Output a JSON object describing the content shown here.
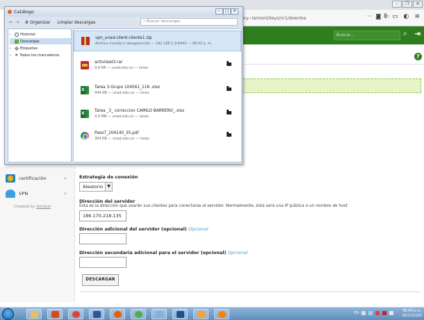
{
  "browser": {
    "url": "ory~lamient/keys/nr1/downloa",
    "search_placeholder": "Buscar..."
  },
  "catalog": {
    "title": "Catálogo",
    "organize_label": "Organizar",
    "clear_label": "Limpiar descargas",
    "search_placeholder": "Buscar descargas",
    "window_controls": [
      "–",
      "□",
      "✕"
    ],
    "tree": [
      {
        "label": "Historial",
        "icon": "clock-icon"
      },
      {
        "label": "Descargas",
        "icon": "download-icon",
        "selected": true
      },
      {
        "label": "Etiquetas",
        "icon": "tag-icon"
      },
      {
        "label": "Todos los marcadores",
        "icon": "star-icon"
      }
    ],
    "downloads": [
      {
        "name": "vpn_unad-client-cliente1.zip",
        "status": "Archivo movido o desaparecido — 192.168.1.9:8443 — 08:03 p. m.",
        "type": "zip",
        "selected": true
      },
      {
        "name": "actividad3.rar",
        "status": "9,8 KB — unad.edu.co — lunes",
        "type": "rar"
      },
      {
        "name": "Tarea 3-Grupo 104561_118 .xlsx",
        "status": "444 KB — unad.edu.co — lunes",
        "type": "xlsx"
      },
      {
        "name": "Tarea _3_ correccion CAMILO BARRERO_.xlsx",
        "status": "4,0 MB — unad.edu.co — lunes",
        "type": "xlsx"
      },
      {
        "name": "Paso7_204140_35.pdf",
        "status": "364 KB — unad.edu.co — lunes",
        "type": "pdf"
      }
    ]
  },
  "sidebar": {
    "items": [
      {
        "label": "certificación",
        "icon": "certificate-icon"
      },
      {
        "label": "VPN",
        "icon": "vpn-icon"
      }
    ],
    "created_by_prefix": "Created by",
    "created_by_link": "Zentyal"
  },
  "form": {
    "strategy_label": "Estrategia de conexión",
    "strategy_value": "Aleatorio",
    "server_label": "Dirección del servidor",
    "server_help": "Esta es la dirección que usarán sus clientes para conectarse al servidor. Normalmente, ésta será una IP pública o un nombre de host",
    "server_value": "186.170.218.135",
    "additional_label": "Dirección adicional del servidor (opcional)",
    "additional_optional": "Opcional",
    "secondary_label": "Dirección secundaria adicional para el servidor (opcional)",
    "secondary_optional": "Opcional",
    "download_label": "DESCARGAR"
  },
  "taskbar": {
    "tray_text": "ES",
    "time": "08:04 p.m.",
    "date": "26/11/2020"
  },
  "colors": {
    "accent_green": "#2e7d1e",
    "notice_green": "#e5f5c8",
    "optional_blue": "#3a9bd5"
  }
}
